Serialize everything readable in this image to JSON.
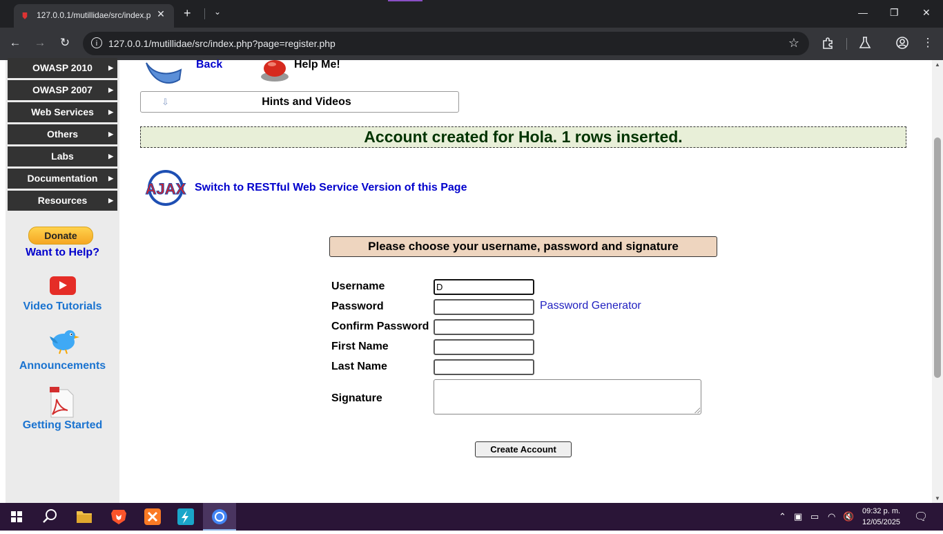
{
  "browser": {
    "tab_title": "127.0.0.1/mutillidae/src/index.p",
    "tab_close": "✕",
    "new_tab": "+",
    "tab_list": "⌄",
    "url": "127.0.0.1/mutillidae/src/index.php?page=register.php",
    "minimize": "—",
    "restore": "❐",
    "close": "✕"
  },
  "sidebar": {
    "menu": [
      {
        "label": "OWASP 2010"
      },
      {
        "label": "OWASP 2007"
      },
      {
        "label": "Web Services"
      },
      {
        "label": "Others"
      },
      {
        "label": "Labs"
      },
      {
        "label": "Documentation"
      },
      {
        "label": "Resources"
      }
    ],
    "donate_label": "Donate",
    "want_help": "Want to Help?",
    "video_tutorials": "Video Tutorials",
    "announcements": "Announcements",
    "getting_started": "Getting Started"
  },
  "main": {
    "back_label": "Back",
    "help_label": "Help Me!",
    "hints_label": "Hints and Videos",
    "success_message": "Account created for Hola. 1 rows inserted.",
    "restful_link": "Switch to RESTful Web Service Version of this Page",
    "ajax_logo_text": "AJAX"
  },
  "form": {
    "header": "Please choose your username, password and signature",
    "fields": [
      {
        "label": "Username",
        "value": "D"
      },
      {
        "label": "Password",
        "value": ""
      },
      {
        "label": "Confirm Password",
        "value": ""
      },
      {
        "label": "First Name",
        "value": ""
      },
      {
        "label": "Last Name",
        "value": ""
      }
    ],
    "signature_label": "Signature",
    "password_generator": "Password Generator",
    "submit_label": "Create Account"
  },
  "taskbar": {
    "time": "09:32 p. m.",
    "date": "12/05/2025"
  },
  "colors": {
    "link_blue": "#0000cc",
    "success_bg": "#e8efd8",
    "success_text": "#003300",
    "form_header_bg": "#eed5bf",
    "menu_bg": "#333333",
    "taskbar_bg": "#2a1537"
  }
}
